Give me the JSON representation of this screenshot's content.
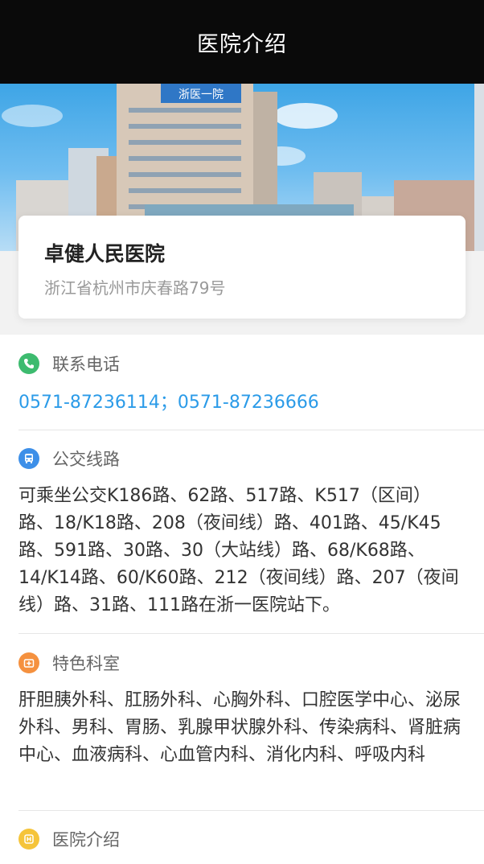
{
  "header": {
    "title": "医院介绍"
  },
  "hero": {
    "building_sign": "浙医一院"
  },
  "hospital": {
    "name": "卓健人民医院",
    "address": "浙江省杭州市庆春路79号"
  },
  "sections": {
    "contact": {
      "title": "联系电话",
      "icon": "phone-icon",
      "color": "#3dbb6f",
      "value": "0571-87236114；0571-87236666"
    },
    "bus": {
      "title": "公交线路",
      "icon": "bus-icon",
      "color": "#3d8fe8",
      "value": "可乘坐公交K186路、62路、517路、K517（区间）路、18/K18路、208（夜间线）路、401路、45/K45路、591路、30路、30（大站线）路、68/K68路、14/K14路、60/K60路、212（夜间线）路、207（夜间线）路、31路、111路在浙一医院站下。"
    },
    "departments": {
      "title": "特色科室",
      "icon": "medical-kit-icon",
      "color": "#f5913f",
      "value": "肝胆胰外科、肛肠外科、心胸外科、口腔医学中心、泌尿外科、男科、胃肠、乳腺甲状腺外科、传染病科、肾脏病中心、血液病科、心血管内科、消化内科、呼吸内科"
    },
    "intro": {
      "title": "医院介绍",
      "icon": "hospital-icon",
      "color": "#f5c43a"
    }
  }
}
